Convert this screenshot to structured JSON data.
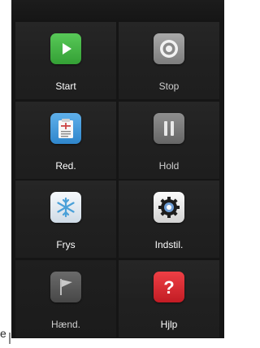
{
  "tiles": [
    {
      "id": "start",
      "label": "Start",
      "icon": "play-icon",
      "color": "#3aa53a"
    },
    {
      "id": "stop",
      "label": "Stop",
      "icon": "stop-target-icon",
      "color": "#8a8a8a"
    },
    {
      "id": "red",
      "label": "Red.",
      "icon": "clipboard-edit-icon",
      "color": "#3a93d6"
    },
    {
      "id": "hold",
      "label": "Hold",
      "icon": "pause-icon",
      "color": "#7a7a7a"
    },
    {
      "id": "frys",
      "label": "Frys",
      "icon": "snowflake-icon",
      "color": "#dfe9f1"
    },
    {
      "id": "indstil",
      "label": "Indstil.",
      "icon": "gear-icon",
      "color": "#e6e6e6"
    },
    {
      "id": "haend",
      "label": "Hænd.",
      "icon": "flag-icon",
      "color": "#5a5a5a"
    },
    {
      "id": "hjlp",
      "label": "Hjlp",
      "icon": "help-question-icon",
      "color": "#d8262e"
    }
  ],
  "stray_text": "e"
}
